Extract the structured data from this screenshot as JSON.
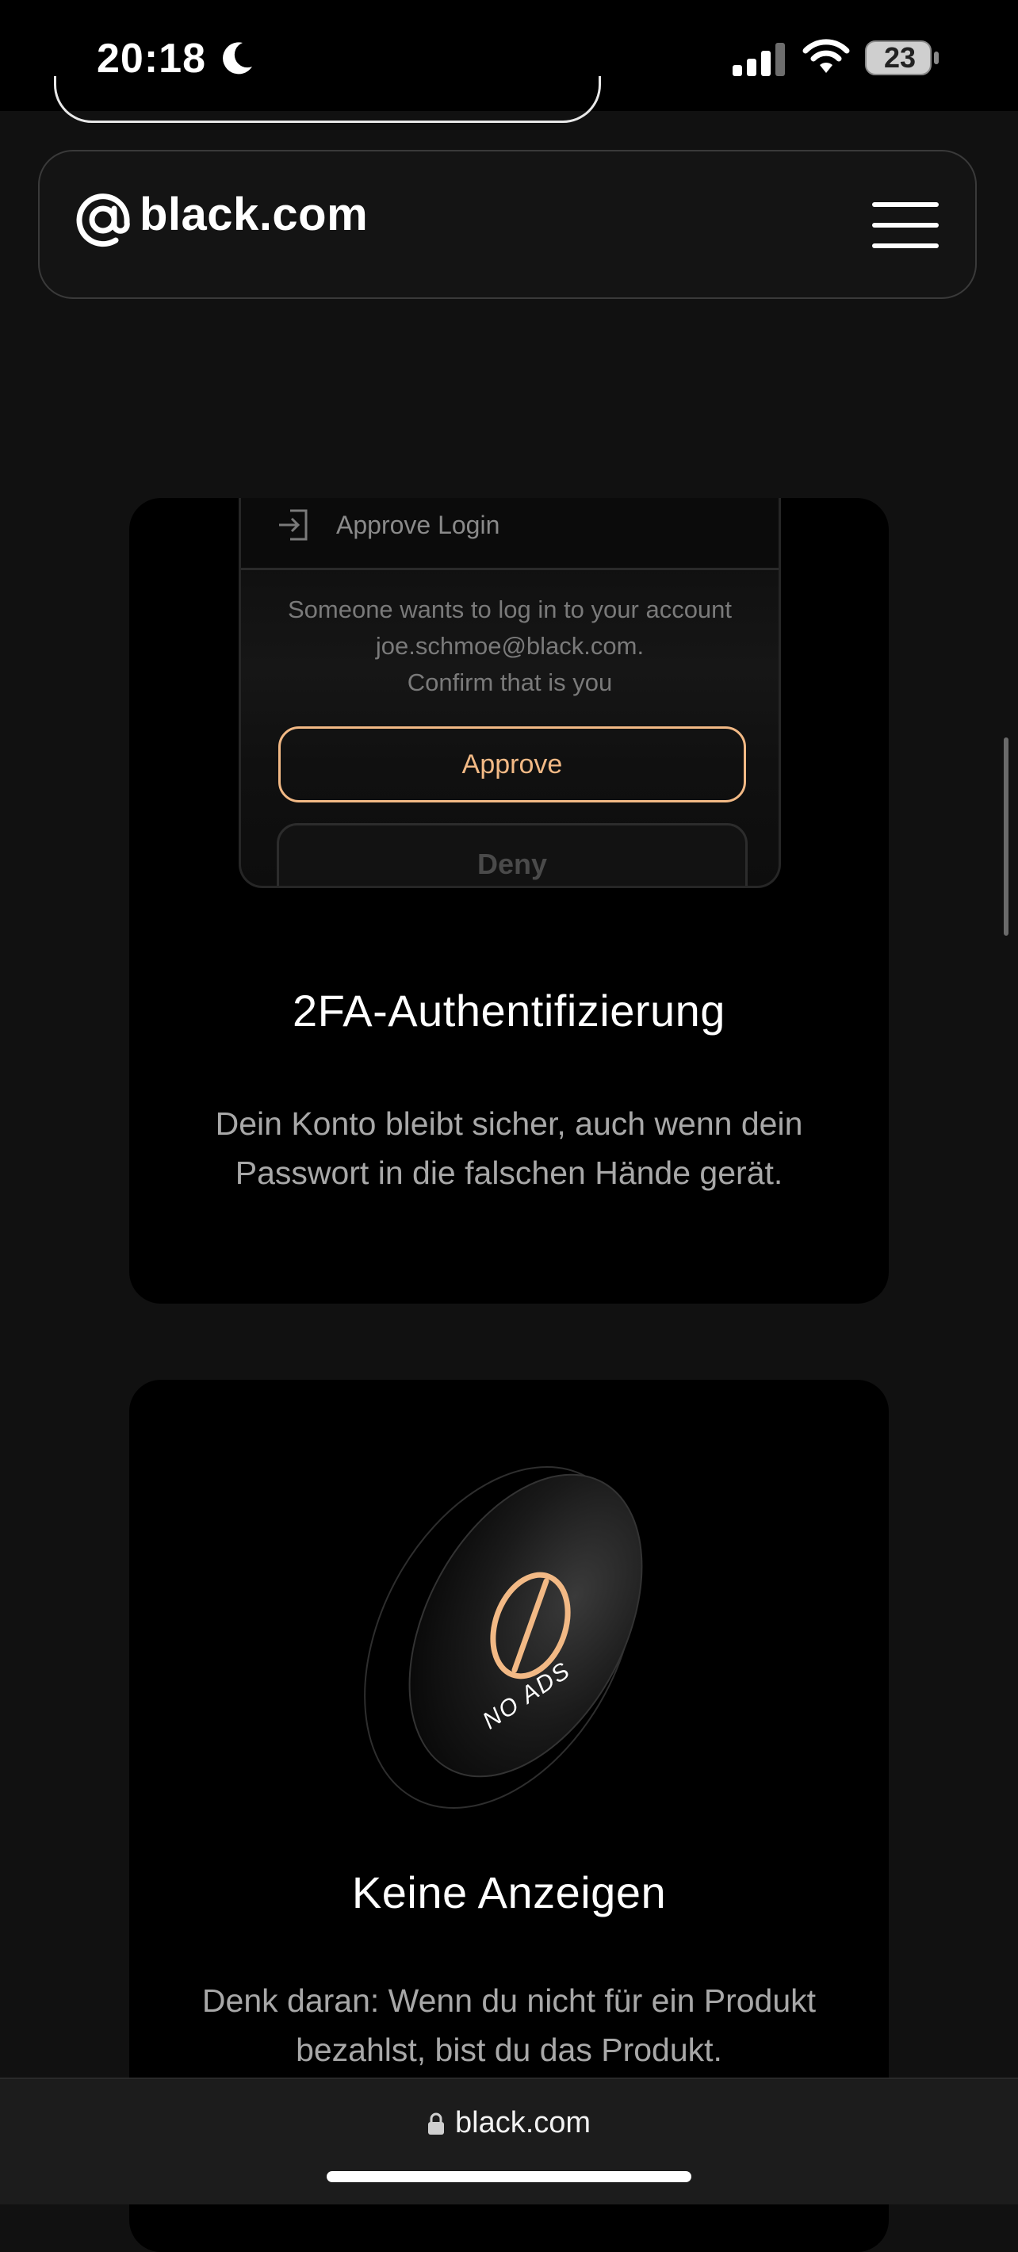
{
  "status_bar": {
    "time": "20:18",
    "moon_icon": "moon-icon",
    "signal_icon": "cellular-signal-icon",
    "wifi_icon": "wifi-icon",
    "battery_level": "23"
  },
  "header": {
    "logo_text": "black.com",
    "logo_icon": "at-sign-icon",
    "menu_icon": "hamburger-menu-icon"
  },
  "card_2fa": {
    "mock": {
      "title": "Approve Login",
      "message_line1": "Someone wants to log in to your account",
      "message_line2": "joe.schmoe@black.com.",
      "message_line3": "Confirm that is you",
      "approve_label": "Approve",
      "deny_label": "Deny"
    },
    "title": "2FA-Authentifizierung",
    "description": "Dein Konto bleibt sicher, auch wenn dein Passwort in die falschen Hände gerät."
  },
  "card_noads": {
    "art_label": "NO ADS",
    "title": "Keine Anzeigen",
    "description": "Denk daran: Wenn du nicht für ein Produkt bezahlst, bist du das Produkt."
  },
  "url_bar": {
    "url": "black.com",
    "lock_icon": "lock-icon"
  },
  "colors": {
    "background": "#111111",
    "card": "#000000",
    "accent": "#f2b985"
  }
}
